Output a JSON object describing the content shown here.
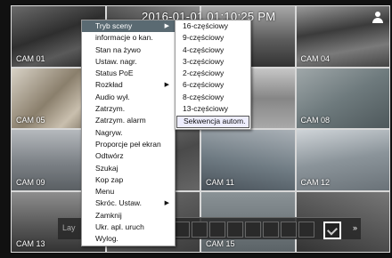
{
  "timestamp": "2016-01-01 01:10:25 PM",
  "cameras": [
    {
      "label": "CAM 01"
    },
    {
      "label": ""
    },
    {
      "label": ""
    },
    {
      "label": "CAM 04"
    },
    {
      "label": "CAM 05"
    },
    {
      "label": ""
    },
    {
      "label": ""
    },
    {
      "label": "CAM 08"
    },
    {
      "label": "CAM 09"
    },
    {
      "label": ""
    },
    {
      "label": "CAM 11"
    },
    {
      "label": "CAM 12"
    },
    {
      "label": "CAM 13"
    },
    {
      "label": ""
    },
    {
      "label": "CAM 15"
    },
    {
      "label": ""
    }
  ],
  "toolbar": {
    "label": "Lay",
    "more": "»"
  },
  "main_menu": {
    "items": [
      {
        "label": "Tryb sceny",
        "submenu": true,
        "highlighted": true
      },
      {
        "label": "informacje o kan."
      },
      {
        "label": "Stan na żywo"
      },
      {
        "label": "Ustaw. nagr."
      },
      {
        "label": "Status PoE"
      },
      {
        "label": "Rozkład",
        "submenu": true
      },
      {
        "label": "Audio wył."
      },
      {
        "label": "Zatrzym."
      },
      {
        "label": "Zatrzym. alarm"
      },
      {
        "label": "Nagryw."
      },
      {
        "label": "Proporcje peł ekran"
      },
      {
        "label": "Odtwórz"
      },
      {
        "label": "Szukaj"
      },
      {
        "label": "Kop zap"
      },
      {
        "label": "Menu"
      },
      {
        "label": "Skróc. Ustaw.",
        "submenu": true
      },
      {
        "label": "Zamknij"
      },
      {
        "label": "Ukr. apl. uruch"
      },
      {
        "label": "Wylog."
      }
    ],
    "arrow": "▶"
  },
  "scene_submenu": {
    "items": [
      {
        "label": "16-częściowy"
      },
      {
        "label": "9-częściowy"
      },
      {
        "label": "4-częściowy"
      },
      {
        "label": "3-częściowy"
      },
      {
        "label": "2-częściowy"
      },
      {
        "label": "6-częściowy"
      },
      {
        "label": "8-częściowy"
      },
      {
        "label": "13-częściowy"
      },
      {
        "label": "Sekwencja autom.",
        "selected": true
      }
    ]
  }
}
